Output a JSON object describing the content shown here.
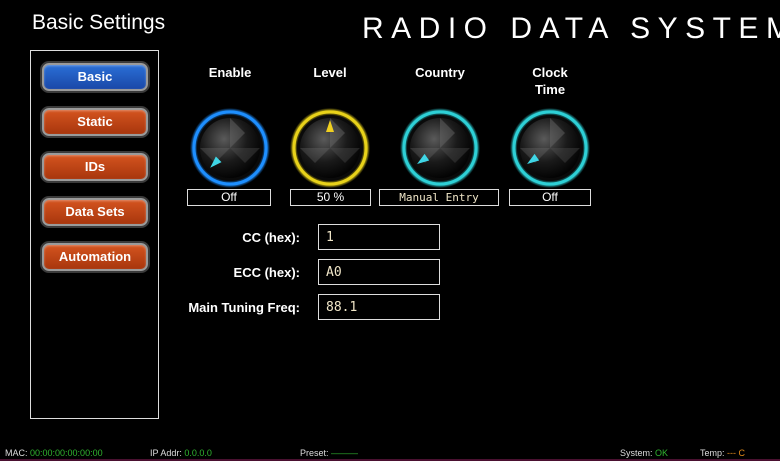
{
  "header": {
    "page_title": "Basic Settings",
    "app_title": "RADIO DATA SYSTEM"
  },
  "sidebar": {
    "items": [
      {
        "label": "Basic",
        "active": true
      },
      {
        "label": "Static",
        "active": false
      },
      {
        "label": "IDs",
        "active": false
      },
      {
        "label": "Data Sets",
        "active": false
      },
      {
        "label": "Automation",
        "active": false
      }
    ]
  },
  "knobs": [
    {
      "label_line1": "",
      "label_line2": "Enable",
      "value": "Off",
      "ring_color": "#1e8fff",
      "pointer_color": "#3fd6e6"
    },
    {
      "label_line1": "",
      "label_line2": "Level",
      "value": "50 %",
      "ring_color": "#e8d21a",
      "pointer_color": "#f0d020"
    },
    {
      "label_line1": "",
      "label_line2": "Country",
      "value": "Manual Entry",
      "ring_color": "#2ed0d6",
      "pointer_color": "#3fd6e6"
    },
    {
      "label_line1": "Clock",
      "label_line2": "Time",
      "value": "Off",
      "ring_color": "#2ed0d6",
      "pointer_color": "#3fd6e6"
    }
  ],
  "fields": [
    {
      "label": "CC (hex):",
      "value": "1"
    },
    {
      "label": "ECC (hex):",
      "value": "A0"
    },
    {
      "label": "Main Tuning Freq:",
      "value": "88.1"
    }
  ],
  "status": {
    "mac_label": "MAC:",
    "mac_value": "00:00:00:00:00:00",
    "ip_label": "IP Addr:",
    "ip_value": "0.0.0.0",
    "preset_label": "Preset:",
    "preset_value": "———",
    "system_label": "System:",
    "system_value": "OK",
    "temp_label": "Temp:",
    "temp_value": "--- C"
  }
}
